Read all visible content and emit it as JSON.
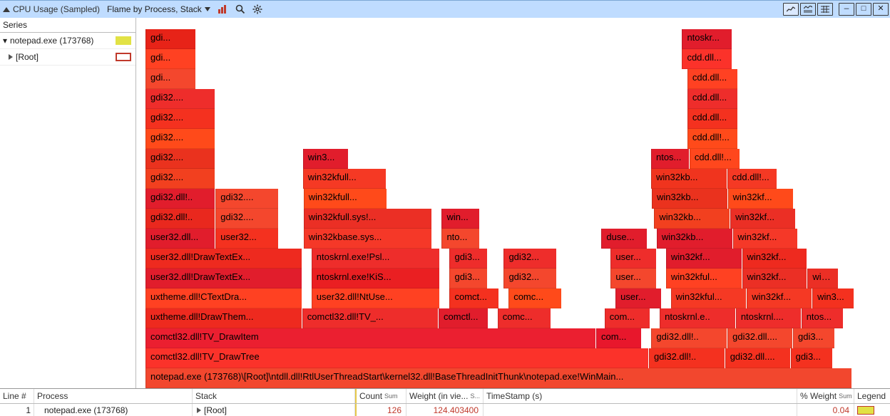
{
  "titlebar": {
    "title_text": "CPU Usage (Sampled)",
    "preset_label": "Flame by Process, Stack"
  },
  "series": {
    "header": "Series",
    "items": [
      {
        "label": "notepad.exe (173768)",
        "swatch": "gold"
      },
      {
        "label": "[Root]",
        "swatch": "gold-outline"
      }
    ]
  },
  "flame": {
    "rows": [
      [
        {
          "gap": 1.0
        },
        {
          "t": "gdi...",
          "c": "#e72318",
          "w": 6.6
        },
        {
          "gap": 64.4
        },
        {
          "t": "ntoskr...",
          "c": "#e11d2c",
          "w": 6.6
        },
        {
          "gap": 15.4
        }
      ],
      [
        {
          "gap": 1.0
        },
        {
          "t": "gdi...",
          "c": "#ff4122",
          "w": 6.6
        },
        {
          "gap": 64.4
        },
        {
          "t": "cdd.dll...",
          "c": "#fb322a",
          "w": 6.6
        },
        {
          "gap": 15.4
        }
      ],
      [
        {
          "gap": 0.3
        },
        {
          "t": "gdi...",
          "c": "#f4472d",
          "w": 6.6
        },
        {
          "gap": 65.1
        },
        {
          "t": "cdd.dll...",
          "c": "#ff4122",
          "w": 6.6
        },
        {
          "gap": 15.4
        }
      ],
      [
        {
          "gap": 0.3
        },
        {
          "t": "gdi32....",
          "c": "#ee2d2b",
          "w": 9.2
        },
        {
          "gap": 62.5
        },
        {
          "t": "cdd.dll...",
          "c": "#ee2d2b",
          "w": 6.6
        },
        {
          "gap": 15.4
        }
      ],
      [
        {
          "gap": 0.3
        },
        {
          "t": "gdi32....",
          "c": "#f4311f",
          "w": 9.2
        },
        {
          "gap": 62.5
        },
        {
          "t": "cdd.dll...",
          "c": "#f4311f",
          "w": 6.6
        },
        {
          "gap": 15.4
        }
      ],
      [
        {
          "gap": 0.3
        },
        {
          "t": "gdi32....",
          "c": "#ff4a1a",
          "w": 9.2
        },
        {
          "gap": 62.5
        },
        {
          "t": "cdd.dll!...",
          "c": "#ff4a1a",
          "w": 6.6
        },
        {
          "gap": 15.4
        }
      ],
      [
        {
          "gap": 0.3
        },
        {
          "t": "gdi32....",
          "c": "#ea321e",
          "w": 9.2
        },
        {
          "gap": 11.5
        },
        {
          "t": "win3...",
          "c": "#e11d2c",
          "w": 6.0
        },
        {
          "gap": 40.0
        },
        {
          "t": "ntos...",
          "c": "#e11d2c",
          "w": 5.0
        },
        {
          "t": "cdd.dll!...",
          "c": "#ff471d",
          "w": 6.6
        },
        {
          "gap": 15.4
        }
      ],
      [
        {
          "gap": 0.3
        },
        {
          "t": "gdi32....",
          "c": "#f2401f",
          "w": 9.2
        },
        {
          "gap": 11.5
        },
        {
          "t": "win32kfull...",
          "c": "#f53924",
          "w": 11.0
        },
        {
          "gap": 35.0
        },
        {
          "t": "win32kb...",
          "c": "#f0341e",
          "w": 10.0
        },
        {
          "t": "cdd.dll!...",
          "c": "#f53924",
          "w": 6.6
        },
        {
          "gap": 10.4
        }
      ],
      [
        {
          "gap": 0.3
        },
        {
          "t": "gdi32.dll!..",
          "c": "#e11d2c",
          "w": 9.2
        },
        {
          "t": "gdi32....",
          "c": "#f4472d",
          "w": 8.3
        },
        {
          "gap": 3.2
        },
        {
          "t": "win32kfull...",
          "c": "#ff4a1a",
          "w": 11.0
        },
        {
          "gap": 35.0
        },
        {
          "t": "win32kb...",
          "c": "#ea321e",
          "w": 10.0
        },
        {
          "t": "win32kf...",
          "c": "#ff4a1a",
          "w": 8.6
        },
        {
          "gap": 8.4
        }
      ],
      [
        {
          "gap": 0.3
        },
        {
          "t": "gdi32.dll!..",
          "c": "#e9281e",
          "w": 9.2
        },
        {
          "t": "gdi32....",
          "c": "#f4472d",
          "w": 8.3
        },
        {
          "gap": 3.2
        },
        {
          "t": "win32kfull.sys!...",
          "c": "#eb2f25",
          "w": 17.0
        },
        {
          "gap": 1.0
        },
        {
          "t": "win...",
          "c": "#e11d2c",
          "w": 5.0
        },
        {
          "gap": 23.0
        },
        {
          "t": "win32kb...",
          "c": "#f2401f",
          "w": 10.0
        },
        {
          "t": "win32kf...",
          "c": "#eb2f25",
          "w": 8.6
        },
        {
          "gap": 8.4
        }
      ],
      [
        {
          "gap": 0.3
        },
        {
          "t": "user32.dll...",
          "c": "#e11d2c",
          "w": 9.2
        },
        {
          "t": "user32...",
          "c": "#f4311f",
          "w": 8.3
        },
        {
          "gap": 3.2
        },
        {
          "t": "win32kbase.sys...",
          "c": "#f53828",
          "w": 17.0
        },
        {
          "gap": 1.0
        },
        {
          "t": "nto...",
          "c": "#f4472d",
          "w": 5.0
        },
        {
          "gap": 16.0
        },
        {
          "t": "duse...",
          "c": "#e11d2c",
          "w": 6.0
        },
        {
          "gap": 1.0
        },
        {
          "t": "win32kb...",
          "c": "#e11d2c",
          "w": 10.0
        },
        {
          "t": "win32kf...",
          "c": "#f53828",
          "w": 8.6
        },
        {
          "gap": 8.4
        }
      ],
      [
        {
          "gap": 0.3
        },
        {
          "t": "user32.dll!DrawTextEx...",
          "c": "#ee2a1f",
          "w": 20.7
        },
        {
          "gap": 0.0
        },
        {
          "t": "ntoskrnl.exe!Psl...",
          "c": "#ee2d2b",
          "w": 17.0
        },
        {
          "gap": 1.0
        },
        {
          "t": "gdi3...",
          "c": "#ee2d2b",
          "w": 5.0
        },
        {
          "gap": 2.0
        },
        {
          "t": "gdi32...",
          "c": "#ee2d2b",
          "w": 7.0
        },
        {
          "gap": 7.0
        },
        {
          "t": "user...",
          "c": "#ee2d2b",
          "w": 6.0
        },
        {
          "gap": 1.0
        },
        {
          "t": "win32kf...",
          "c": "#e11d2c",
          "w": 10.0
        },
        {
          "t": "win32kf...",
          "c": "#ee2a1f",
          "w": 8.6
        },
        {
          "gap": 8.4
        }
      ],
      [
        {
          "gap": 0.3
        },
        {
          "t": "user32.dll!DrawTextEx...",
          "c": "#e11d2c",
          "w": 20.7
        },
        {
          "gap": 0.0
        },
        {
          "t": "ntoskrnl.exe!KiS...",
          "c": "#ea1f22",
          "w": 17.0
        },
        {
          "gap": 1.0
        },
        {
          "t": "gdi3...",
          "c": "#f4472d",
          "w": 5.0
        },
        {
          "gap": 2.0
        },
        {
          "t": "gdi32...",
          "c": "#f4472d",
          "w": 7.0
        },
        {
          "gap": 7.0
        },
        {
          "t": "user...",
          "c": "#f4472d",
          "w": 6.0
        },
        {
          "gap": 1.0
        },
        {
          "t": "win32kful...",
          "c": "#ff4122",
          "w": 10.0
        },
        {
          "t": "win32kf...",
          "c": "#eb2f25",
          "w": 8.6
        },
        {
          "t": "win...",
          "c": "#eb2f25",
          "w": 4.0
        },
        {
          "gap": 4.4
        }
      ],
      [
        {
          "gap": 0.3
        },
        {
          "t": "uxtheme.dll!CTextDra...",
          "c": "#ff4122",
          "w": 20.7
        },
        {
          "gap": 0.0
        },
        {
          "t": "user32.dll!NtUse...",
          "c": "#ff4122",
          "w": 17.0
        },
        {
          "gap": 1.0
        },
        {
          "t": "comct...",
          "c": "#f4311f",
          "w": 6.5
        },
        {
          "gap": 0.5
        },
        {
          "t": "comc...",
          "c": "#ff4a1a",
          "w": 7.0
        },
        {
          "gap": 7.0
        },
        {
          "t": "user...",
          "c": "#e11d2c",
          "w": 6.0
        },
        {
          "gap": 1.0
        },
        {
          "t": "win32kful...",
          "c": "#f53924",
          "w": 10.0
        },
        {
          "t": "win32kf...",
          "c": "#f53924",
          "w": 8.6
        },
        {
          "t": "win3...",
          "c": "#f4311f",
          "w": 5.5
        },
        {
          "gap": 2.9
        }
      ],
      [
        {
          "gap": 0.3
        },
        {
          "t": "uxtheme.dll!DrawThem...",
          "c": "#ee2a1f",
          "w": 20.7
        },
        {
          "t": "comctl32.dll!TV_...",
          "c": "#ee2d2b",
          "w": 18.0
        },
        {
          "t": "comctl...",
          "c": "#e11d2c",
          "w": 6.5
        },
        {
          "gap": 0.5
        },
        {
          "t": "comc...",
          "c": "#ee2d2b",
          "w": 7.0
        },
        {
          "gap": 7.0
        },
        {
          "t": "com...",
          "c": "#ee2d2b",
          "w": 6.0
        },
        {
          "gap": 1.0
        },
        {
          "t": "ntoskrnl.e..",
          "c": "#ee2d2b",
          "w": 10.0
        },
        {
          "t": "ntoskrnl....",
          "c": "#ee2d2b",
          "w": 8.6
        },
        {
          "t": "ntos...",
          "c": "#ee2d2b",
          "w": 5.5
        },
        {
          "gap": 2.9
        }
      ],
      [
        {
          "gap": 0.3
        },
        {
          "t": "comctl32.dll!TV_DrawItem",
          "c": "#eb1f30",
          "w": 59.7
        },
        {
          "t": "com...",
          "c": "#e8172c",
          "w": 6.0
        },
        {
          "gap": 1.0
        },
        {
          "t": "gdi32.dll!..",
          "c": "#f4472d",
          "w": 10.0
        },
        {
          "t": "gdi32.dll....",
          "c": "#f4472d",
          "w": 8.6
        },
        {
          "t": "gdi3...",
          "c": "#f4472d",
          "w": 5.5
        },
        {
          "gap": 2.9
        }
      ],
      [
        {
          "gap": 0.3
        },
        {
          "t": "comctl32.dll!TV_DrawTree",
          "c": "#fb322a",
          "w": 66.7
        },
        {
          "t": "gdi32.dll!..",
          "c": "#f4311f",
          "w": 10.0
        },
        {
          "t": "gdi32.dll....",
          "c": "#f4311f",
          "w": 8.6
        },
        {
          "t": "gdi3...",
          "c": "#f4311f",
          "w": 5.5
        },
        {
          "gap": 2.9
        }
      ],
      [
        {
          "gap": 0.3
        },
        {
          "t": "notepad.exe  (173768)\\[Root]\\ntdll.dll!RtlUserThreadStart\\kernel32.dll!BaseThreadInitThunk\\notepad.exe!WinMain...",
          "c": "#f2472e",
          "w": 93.7
        }
      ]
    ]
  },
  "table": {
    "columns": {
      "line": "Line #",
      "process": "Process",
      "stack": "Stack",
      "count": "Count",
      "weight": "Weight (in vie...",
      "timestamp": "TimeStamp (s)",
      "pctweight": "% Weight",
      "legend": "Legend",
      "sum": "Sum",
      "s": "S..."
    },
    "row": {
      "line": "1",
      "process": "notepad.exe (173768)",
      "stack": "[Root]",
      "count": "126",
      "weight": "124.403400",
      "timestamp": "",
      "pctweight": "0.04"
    }
  }
}
